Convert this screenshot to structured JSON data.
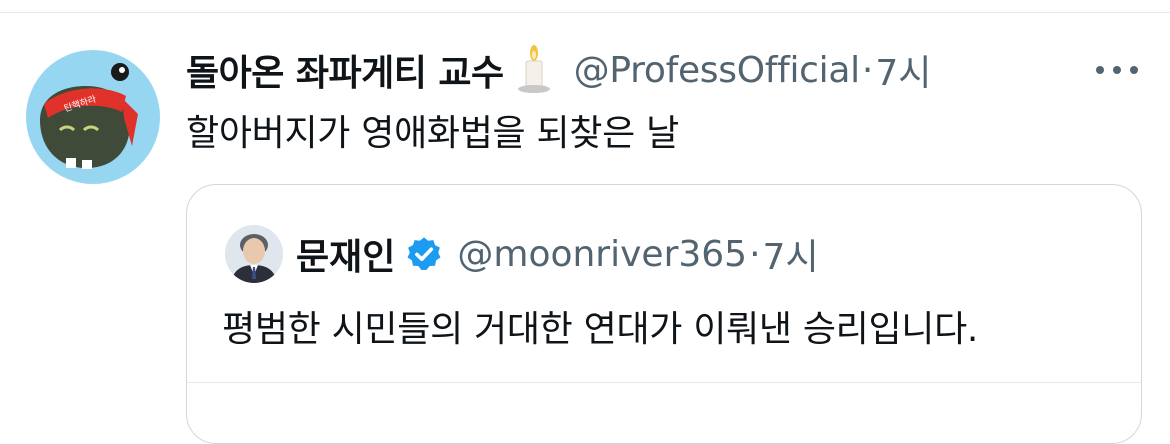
{
  "tweet": {
    "display_name": "돌아온 좌파게티 교수",
    "handle": "@ProfessOfficial",
    "separator": "·",
    "time": "7시",
    "text": "할아버지가 영애화법을 되찾은 날",
    "avatar_headband_text": "탄핵하라",
    "emoji": "candle-icon"
  },
  "quoted_tweet": {
    "display_name": "문재인",
    "handle": "@moonriver365",
    "separator": "·",
    "time": "7시",
    "text": "평범한 시민들의 거대한 연대가 이뤄낸 승리입니다.",
    "verified": true
  },
  "colors": {
    "text_primary": "#0f1419",
    "text_secondary": "#536471",
    "verified_blue": "#1d9bf0",
    "border": "#cfd9de",
    "avatar_bg": "#97d6f1"
  }
}
